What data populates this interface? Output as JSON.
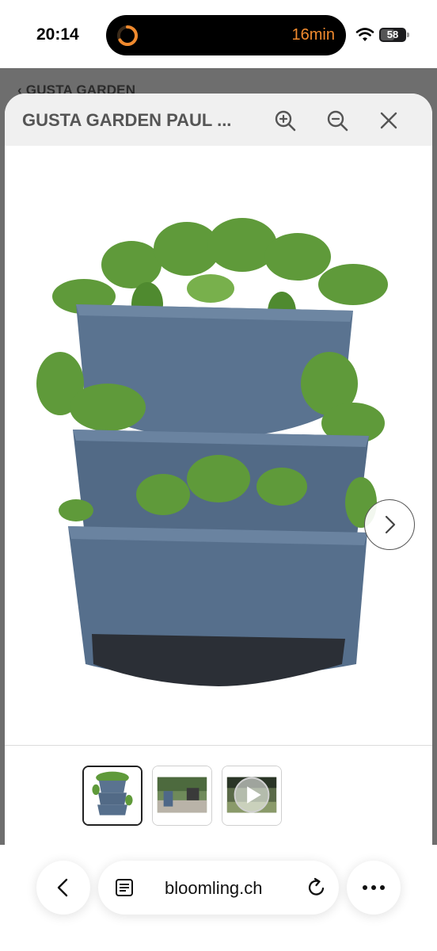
{
  "status_bar": {
    "time": "20:14",
    "activity_timer": "16min",
    "battery_level": "58",
    "battery_fraction": 0.58,
    "activity_color": "#f08a2e"
  },
  "background_page": {
    "breadcrumb": "‹ GUSTA GARDEN"
  },
  "modal": {
    "title": "GUSTA GARDEN PAUL ...",
    "icons": {
      "zoom_in": "zoom-in-icon",
      "zoom_out": "zoom-out-icon",
      "close": "close-icon",
      "next": "chevron-right-icon"
    },
    "main_image": "product-image-tiered-planter",
    "thumbnails": [
      {
        "name": "thumbnail-planter",
        "active": true
      },
      {
        "name": "thumbnail-garden-scene",
        "active": false
      },
      {
        "name": "thumbnail-video",
        "active": false
      }
    ]
  },
  "browser": {
    "url": "bloomling.ch",
    "icons": {
      "back": "chevron-left-icon",
      "reader": "reader-mode-icon",
      "reload": "reload-icon",
      "more": "more-icon"
    }
  }
}
